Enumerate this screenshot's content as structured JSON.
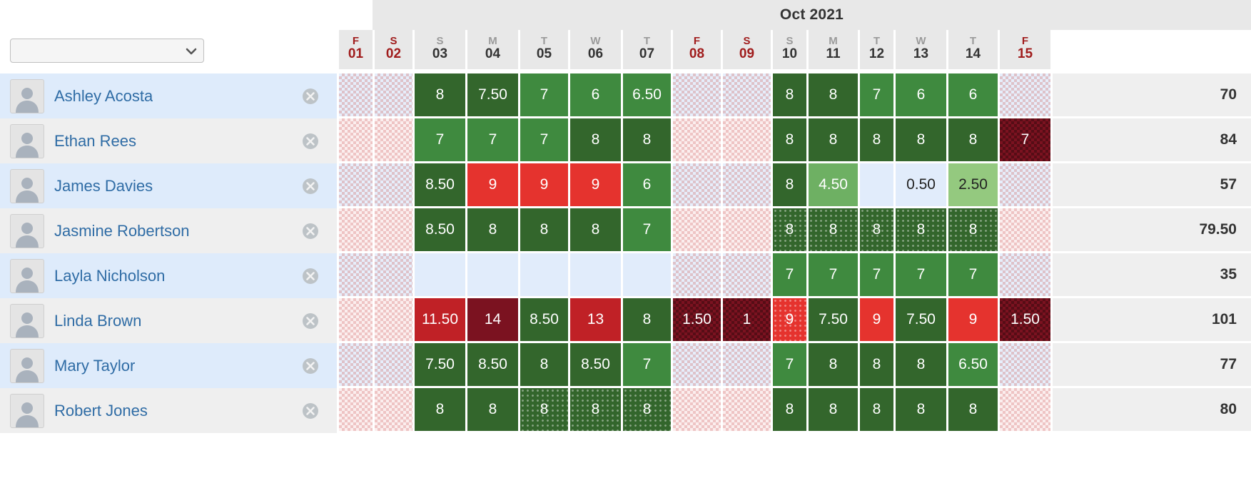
{
  "header": {
    "month_label": "Oct 2021",
    "employee_select_value": "",
    "employee_select_placeholder": ""
  },
  "columns": [
    {
      "dow": "F",
      "day": "01",
      "weekend": true
    },
    {
      "dow": "S",
      "day": "02",
      "weekend": true
    },
    {
      "dow": "S",
      "day": "03",
      "weekend": false
    },
    {
      "dow": "M",
      "day": "04",
      "weekend": false
    },
    {
      "dow": "T",
      "day": "05",
      "weekend": false
    },
    {
      "dow": "W",
      "day": "06",
      "weekend": false
    },
    {
      "dow": "T",
      "day": "07",
      "weekend": false
    },
    {
      "dow": "F",
      "day": "08",
      "weekend": true
    },
    {
      "dow": "S",
      "day": "09",
      "weekend": true
    },
    {
      "dow": "S",
      "day": "10",
      "weekend": false
    },
    {
      "dow": "M",
      "day": "11",
      "weekend": false
    },
    {
      "dow": "T",
      "day": "12",
      "weekend": false
    },
    {
      "dow": "W",
      "day": "13",
      "weekend": false
    },
    {
      "dow": "T",
      "day": "14",
      "weekend": false
    },
    {
      "dow": "F",
      "day": "15",
      "weekend": true
    }
  ],
  "colors": {
    "green_dark": "#33662c",
    "green_mid": "#3f8a3f",
    "green_light": "#6eb063",
    "green_pale": "#94c97f",
    "red_bright": "#e5332e",
    "red_crimson": "#c02126",
    "red_dark": "#7b1220",
    "empty_blue": "#e1ecfb",
    "empty_grey": "#f1f1f1",
    "totals_bg": "#efefef",
    "name_text": "#2f6ca5",
    "weekend_text": "#a01c1c",
    "month_band": "#e8e8e8"
  },
  "rows": [
    {
      "name": "Ashley Acosta",
      "tint": "blue",
      "total": "70",
      "cells": [
        {
          "v": "",
          "style": "weekend"
        },
        {
          "v": "",
          "style": "weekend"
        },
        {
          "v": "8",
          "style": "green_dark"
        },
        {
          "v": "7.50",
          "style": "green_dark"
        },
        {
          "v": "7",
          "style": "green_mid"
        },
        {
          "v": "6",
          "style": "green_mid"
        },
        {
          "v": "6.50",
          "style": "green_mid"
        },
        {
          "v": "",
          "style": "weekend"
        },
        {
          "v": "",
          "style": "weekend"
        },
        {
          "v": "8",
          "style": "green_dark"
        },
        {
          "v": "8",
          "style": "green_dark"
        },
        {
          "v": "7",
          "style": "green_mid"
        },
        {
          "v": "6",
          "style": "green_mid"
        },
        {
          "v": "6",
          "style": "green_mid"
        },
        {
          "v": "",
          "style": "weekend"
        }
      ]
    },
    {
      "name": "Ethan Rees",
      "tint": "grey",
      "total": "84",
      "cells": [
        {
          "v": "",
          "style": "weekend"
        },
        {
          "v": "",
          "style": "weekend"
        },
        {
          "v": "7",
          "style": "green_mid"
        },
        {
          "v": "7",
          "style": "green_mid"
        },
        {
          "v": "7",
          "style": "green_mid"
        },
        {
          "v": "8",
          "style": "green_dark"
        },
        {
          "v": "8",
          "style": "green_dark"
        },
        {
          "v": "",
          "style": "weekend"
        },
        {
          "v": "",
          "style": "weekend"
        },
        {
          "v": "8",
          "style": "green_dark"
        },
        {
          "v": "8",
          "style": "green_dark"
        },
        {
          "v": "8",
          "style": "green_dark"
        },
        {
          "v": "8",
          "style": "green_dark"
        },
        {
          "v": "8",
          "style": "green_dark"
        },
        {
          "v": "7",
          "style": "red_dark_check"
        }
      ]
    },
    {
      "name": "James Davies",
      "tint": "blue",
      "total": "57",
      "cells": [
        {
          "v": "",
          "style": "weekend"
        },
        {
          "v": "",
          "style": "weekend"
        },
        {
          "v": "8.50",
          "style": "green_dark"
        },
        {
          "v": "9",
          "style": "red_bright"
        },
        {
          "v": "9",
          "style": "red_bright"
        },
        {
          "v": "9",
          "style": "red_bright"
        },
        {
          "v": "6",
          "style": "green_mid"
        },
        {
          "v": "",
          "style": "weekend"
        },
        {
          "v": "",
          "style": "weekend"
        },
        {
          "v": "8",
          "style": "green_dark"
        },
        {
          "v": "4.50",
          "style": "green_light"
        },
        {
          "v": "",
          "style": "empty"
        },
        {
          "v": "0.50",
          "style": "empty_val"
        },
        {
          "v": "2.50",
          "style": "green_pale"
        },
        {
          "v": "",
          "style": "weekend"
        }
      ]
    },
    {
      "name": "Jasmine Robertson",
      "tint": "grey",
      "total": "79.50",
      "cells": [
        {
          "v": "",
          "style": "weekend"
        },
        {
          "v": "",
          "style": "weekend"
        },
        {
          "v": "8.50",
          "style": "green_dark"
        },
        {
          "v": "8",
          "style": "green_dark"
        },
        {
          "v": "8",
          "style": "green_dark"
        },
        {
          "v": "8",
          "style": "green_dark"
        },
        {
          "v": "7",
          "style": "green_mid"
        },
        {
          "v": "",
          "style": "weekend"
        },
        {
          "v": "",
          "style": "weekend"
        },
        {
          "v": "8",
          "style": "green_dark_dots"
        },
        {
          "v": "8",
          "style": "green_dark_dots"
        },
        {
          "v": "8",
          "style": "green_dark_dots"
        },
        {
          "v": "8",
          "style": "green_dark_dots"
        },
        {
          "v": "8",
          "style": "green_dark_dots"
        },
        {
          "v": "",
          "style": "weekend"
        }
      ]
    },
    {
      "name": "Layla Nicholson",
      "tint": "blue",
      "total": "35",
      "cells": [
        {
          "v": "",
          "style": "weekend"
        },
        {
          "v": "",
          "style": "weekend"
        },
        {
          "v": "",
          "style": "empty"
        },
        {
          "v": "",
          "style": "empty"
        },
        {
          "v": "",
          "style": "empty"
        },
        {
          "v": "",
          "style": "empty"
        },
        {
          "v": "",
          "style": "empty"
        },
        {
          "v": "",
          "style": "weekend"
        },
        {
          "v": "",
          "style": "weekend"
        },
        {
          "v": "7",
          "style": "green_mid"
        },
        {
          "v": "7",
          "style": "green_mid"
        },
        {
          "v": "7",
          "style": "green_mid"
        },
        {
          "v": "7",
          "style": "green_mid"
        },
        {
          "v": "7",
          "style": "green_mid"
        },
        {
          "v": "",
          "style": "weekend"
        }
      ]
    },
    {
      "name": "Linda Brown",
      "tint": "grey",
      "total": "101",
      "cells": [
        {
          "v": "",
          "style": "weekend"
        },
        {
          "v": "",
          "style": "weekend"
        },
        {
          "v": "11.50",
          "style": "red_crimson"
        },
        {
          "v": "14",
          "style": "red_dark"
        },
        {
          "v": "8.50",
          "style": "green_dark"
        },
        {
          "v": "13",
          "style": "red_crimson"
        },
        {
          "v": "8",
          "style": "green_dark"
        },
        {
          "v": "1.50",
          "style": "red_dark_check"
        },
        {
          "v": "1",
          "style": "red_dark_check"
        },
        {
          "v": "9",
          "style": "red_bright_dots"
        },
        {
          "v": "7.50",
          "style": "green_dark"
        },
        {
          "v": "9",
          "style": "red_bright"
        },
        {
          "v": "7.50",
          "style": "green_dark"
        },
        {
          "v": "9",
          "style": "red_bright"
        },
        {
          "v": "1.50",
          "style": "red_dark_check"
        }
      ]
    },
    {
      "name": "Mary Taylor",
      "tint": "blue",
      "total": "77",
      "cells": [
        {
          "v": "",
          "style": "weekend"
        },
        {
          "v": "",
          "style": "weekend"
        },
        {
          "v": "7.50",
          "style": "green_dark"
        },
        {
          "v": "8.50",
          "style": "green_dark"
        },
        {
          "v": "8",
          "style": "green_dark"
        },
        {
          "v": "8.50",
          "style": "green_dark"
        },
        {
          "v": "7",
          "style": "green_mid"
        },
        {
          "v": "",
          "style": "weekend"
        },
        {
          "v": "",
          "style": "weekend"
        },
        {
          "v": "7",
          "style": "green_mid"
        },
        {
          "v": "8",
          "style": "green_dark"
        },
        {
          "v": "8",
          "style": "green_dark"
        },
        {
          "v": "8",
          "style": "green_dark"
        },
        {
          "v": "6.50",
          "style": "green_mid"
        },
        {
          "v": "",
          "style": "weekend"
        }
      ]
    },
    {
      "name": "Robert Jones",
      "tint": "grey",
      "total": "80",
      "cells": [
        {
          "v": "",
          "style": "weekend"
        },
        {
          "v": "",
          "style": "weekend"
        },
        {
          "v": "8",
          "style": "green_dark"
        },
        {
          "v": "8",
          "style": "green_dark"
        },
        {
          "v": "8",
          "style": "green_dark_dots"
        },
        {
          "v": "8",
          "style": "green_dark_dots"
        },
        {
          "v": "8",
          "style": "green_dark_dots"
        },
        {
          "v": "",
          "style": "weekend"
        },
        {
          "v": "",
          "style": "weekend"
        },
        {
          "v": "8",
          "style": "green_dark"
        },
        {
          "v": "8",
          "style": "green_dark"
        },
        {
          "v": "8",
          "style": "green_dark"
        },
        {
          "v": "8",
          "style": "green_dark"
        },
        {
          "v": "8",
          "style": "green_dark"
        },
        {
          "v": "",
          "style": "weekend"
        }
      ]
    }
  ],
  "icons": {
    "delete": "delete-circle-icon",
    "avatar": "user-avatar-icon",
    "dropdown": "chevron-down-icon"
  }
}
